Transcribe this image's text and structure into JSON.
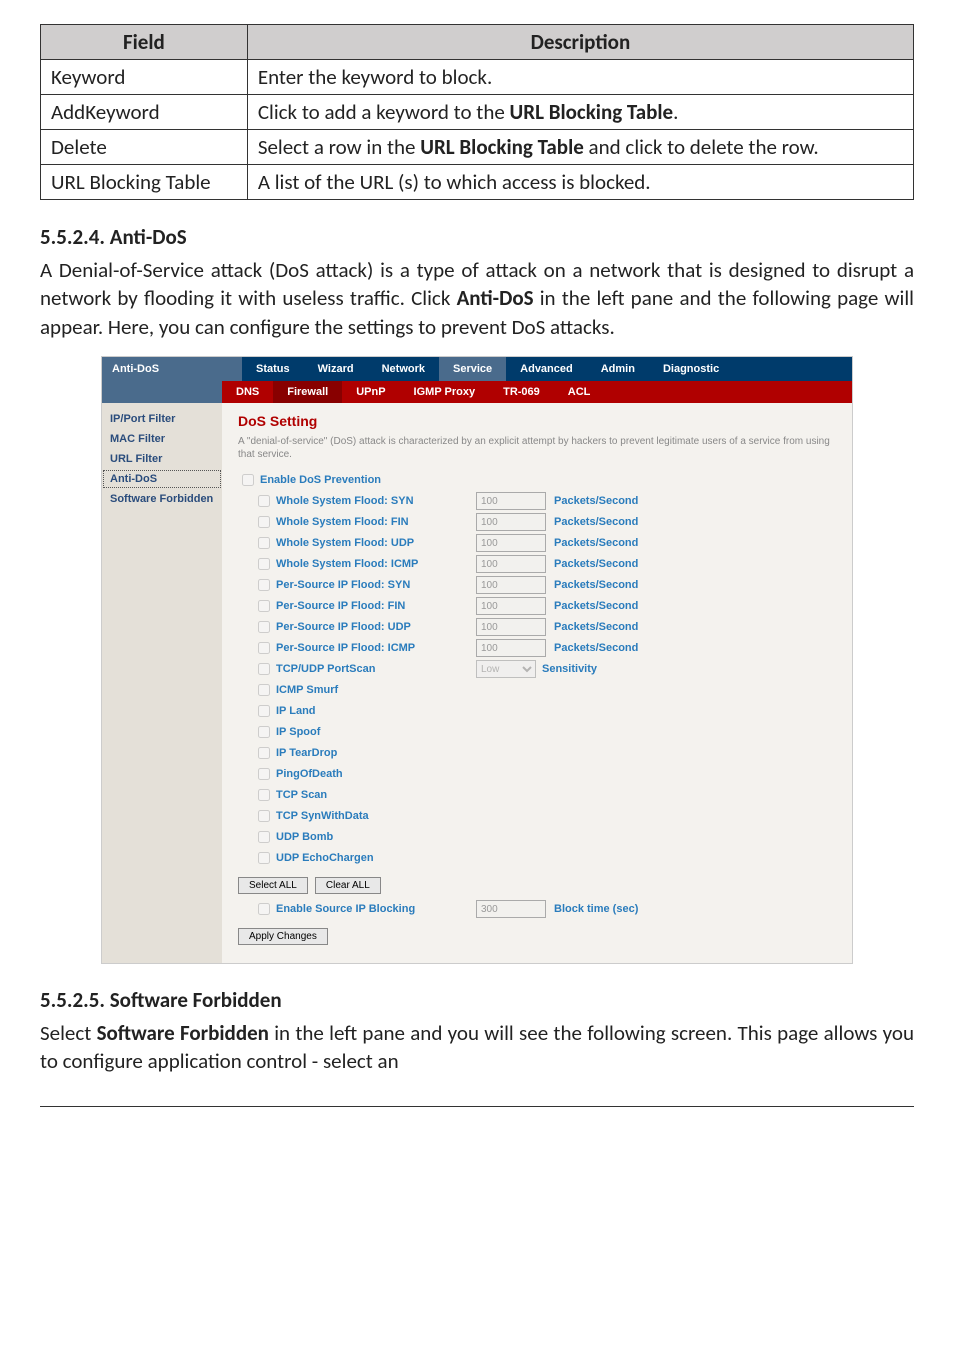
{
  "fieldTable": {
    "header": {
      "col1": "Field",
      "col2": "Description"
    },
    "rows": [
      {
        "field": "Keyword",
        "desc_pre": "Enter the keyword to block.",
        "bold": "",
        "desc_post": ""
      },
      {
        "field": "AddKeyword",
        "desc_pre": "Click to add a keyword to the ",
        "bold": "URL Blocking Table",
        "desc_post": "."
      },
      {
        "field": "Delete",
        "desc_pre": "Select a row in the ",
        "bold": "URL Blocking Table",
        "desc_post": " and click to delete the row."
      },
      {
        "field": "URL Blocking Table",
        "desc_pre": "A list of the URL (s) to which access is blocked.",
        "bold": "",
        "desc_post": ""
      }
    ]
  },
  "section1": {
    "heading": "5.5.2.4.   Anti-DoS",
    "para_a": "A Denial-of-Service attack (DoS attack) is a type of attack on a network that is designed to disrupt a network by flooding it with useless traffic. Click ",
    "para_bold": "Anti-DoS",
    "para_b": " in the left pane and the following page will appear. Here, you can configure the settings to prevent DoS attacks."
  },
  "screenshot": {
    "sidebarLabel": "Anti-DoS",
    "topTabs": [
      "Status",
      "Wizard",
      "Network",
      "Service",
      "Advanced",
      "Admin",
      "Diagnostic"
    ],
    "subTabs": [
      "DNS",
      "Firewall",
      "UPnP",
      "IGMP Proxy",
      "TR-069",
      "ACL"
    ],
    "sidebarItems": [
      "IP/Port Filter",
      "MAC Filter",
      "URL Filter",
      "Anti-DoS",
      "Software Forbidden"
    ],
    "panelTitle": "DoS Setting",
    "panelDesc": "A \"denial-of-service\" (DoS) attack is characterized by an explicit attempt by hackers to prevent legitimate users of a service from using that service.",
    "enableLabel": "Enable DoS Prevention",
    "numOptions": [
      {
        "label": "Whole System Flood: SYN",
        "value": "100",
        "unit": "Packets/Second"
      },
      {
        "label": "Whole System Flood: FIN",
        "value": "100",
        "unit": "Packets/Second"
      },
      {
        "label": "Whole System Flood: UDP",
        "value": "100",
        "unit": "Packets/Second"
      },
      {
        "label": "Whole System Flood: ICMP",
        "value": "100",
        "unit": "Packets/Second"
      },
      {
        "label": "Per-Source IP Flood: SYN",
        "value": "100",
        "unit": "Packets/Second"
      },
      {
        "label": "Per-Source IP Flood: FIN",
        "value": "100",
        "unit": "Packets/Second"
      },
      {
        "label": "Per-Source IP Flood: UDP",
        "value": "100",
        "unit": "Packets/Second"
      },
      {
        "label": "Per-Source IP Flood: ICMP",
        "value": "100",
        "unit": "Packets/Second"
      }
    ],
    "portscan": {
      "label": "TCP/UDP PortScan",
      "select": "Low",
      "unit": "Sensitivity"
    },
    "plainOptions": [
      "ICMP Smurf",
      "IP Land",
      "IP Spoof",
      "IP TearDrop",
      "PingOfDeath",
      "TCP Scan",
      "TCP SynWithData",
      "UDP Bomb",
      "UDP EchoChargen"
    ],
    "selectAll": "Select ALL",
    "clearAll": "Clear ALL",
    "enableBlocking": {
      "label": "Enable Source IP Blocking",
      "value": "300",
      "unit": "Block time (sec)"
    },
    "apply": "Apply Changes"
  },
  "section2": {
    "heading": "5.5.2.5.   Software Forbidden",
    "para_a": "Select ",
    "para_bold": "Software Forbidden",
    "para_b": " in the left pane and you will see the following screen. This page allows you to configure application control - select an"
  }
}
